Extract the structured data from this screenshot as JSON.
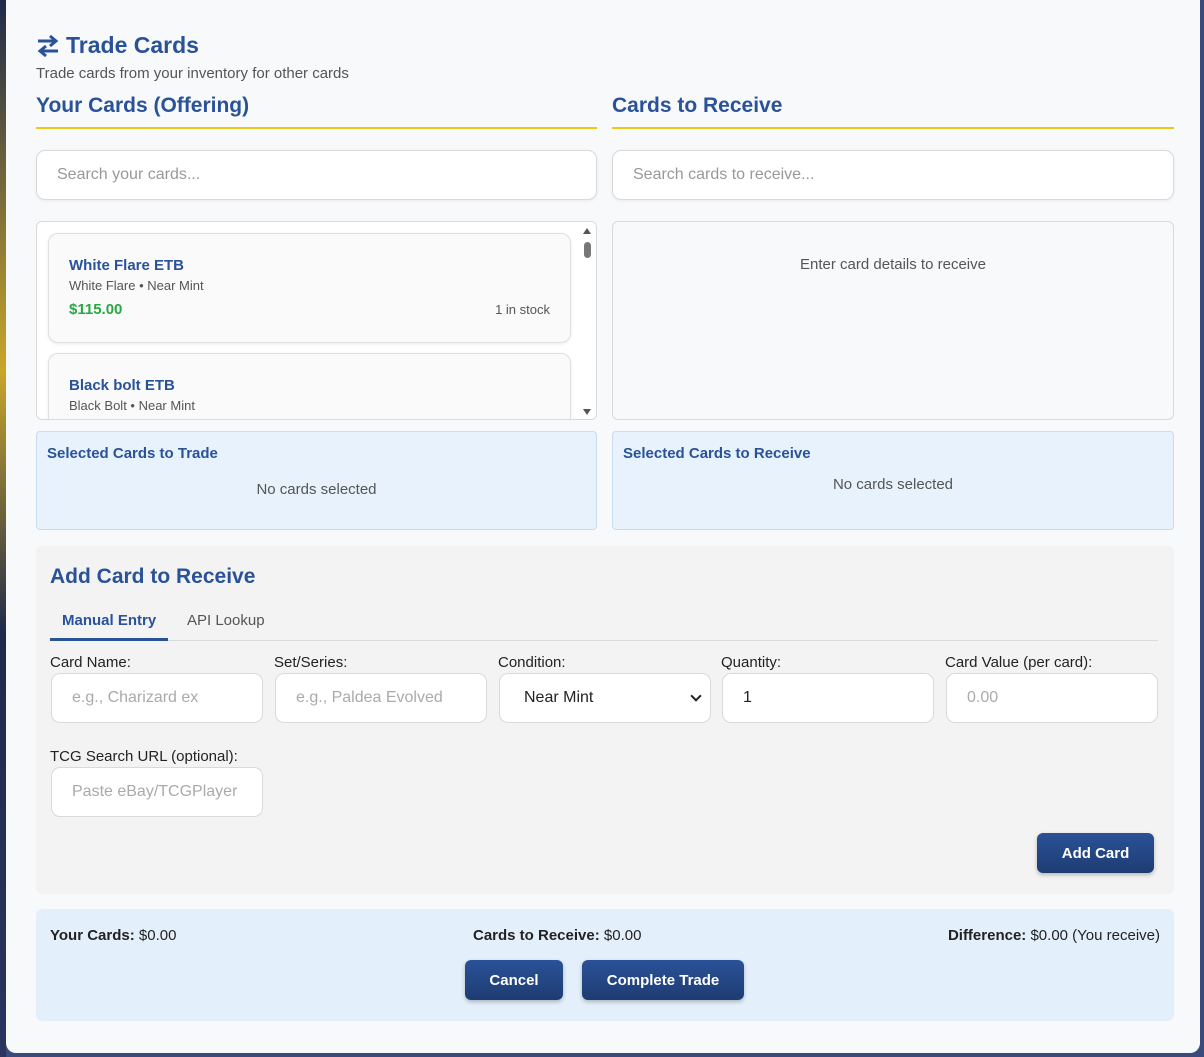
{
  "header": {
    "title": "Trade Cards",
    "subtitle": "Trade cards from your inventory for other cards"
  },
  "offering": {
    "heading": "Your Cards (Offering)",
    "search_placeholder": "Search your cards...",
    "cards": [
      {
        "name": "White Flare ETB",
        "details": "White Flare • Near Mint",
        "price": "$115.00",
        "stock": "1 in stock"
      },
      {
        "name": "Black bolt ETB",
        "details": "Black Bolt • Near Mint"
      }
    ],
    "selected_title": "Selected Cards to Trade",
    "selected_empty": "No cards selected"
  },
  "receiving": {
    "heading": "Cards to Receive",
    "search_placeholder": "Search cards to receive...",
    "empty_message": "Enter card details to receive",
    "selected_title": "Selected Cards to Receive",
    "selected_empty": "No cards selected"
  },
  "add_card": {
    "title": "Add Card to Receive",
    "tabs": [
      {
        "label": "Manual Entry",
        "active": true
      },
      {
        "label": "API Lookup",
        "active": false
      }
    ],
    "fields": {
      "card_name": {
        "label": "Card Name:",
        "placeholder": "e.g., Charizard ex",
        "value": ""
      },
      "set_series": {
        "label": "Set/Series:",
        "placeholder": "e.g., Paldea Evolved",
        "value": ""
      },
      "condition": {
        "label": "Condition:",
        "value": "Near Mint"
      },
      "quantity": {
        "label": "Quantity:",
        "value": "1"
      },
      "card_value": {
        "label": "Card Value (per card):",
        "placeholder": "0.00",
        "value": ""
      },
      "tcg_url": {
        "label": "TCG Search URL (optional):",
        "placeholder": "Paste eBay/TCGPlayer",
        "value": ""
      }
    },
    "add_button": "Add Card"
  },
  "summary": {
    "your_cards_label": "Your Cards:",
    "your_cards_value": "$0.00",
    "receive_label": "Cards to Receive:",
    "receive_value": "$0.00",
    "difference_label": "Difference:",
    "difference_value": "$0.00 (You receive)",
    "cancel_button": "Cancel",
    "complete_button": "Complete Trade"
  },
  "colors": {
    "accent": "#2a5298",
    "underline": "#f0c419",
    "price": "#28a745",
    "panel_blue": "#e7f2fc"
  }
}
